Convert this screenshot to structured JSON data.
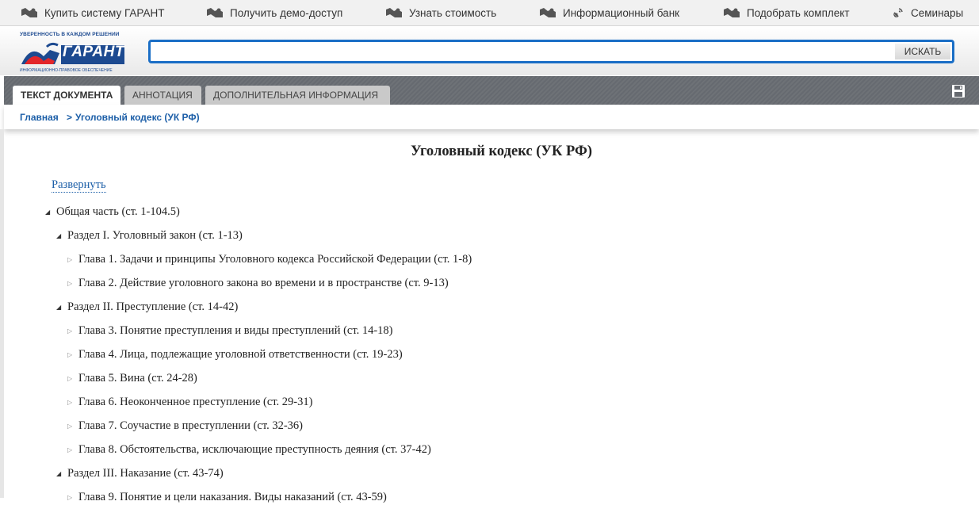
{
  "top_nav": [
    {
      "label": "Купить систему ГАРАНТ",
      "icon": "hand-icon"
    },
    {
      "label": "Получить демо-доступ",
      "icon": "hand-icon"
    },
    {
      "label": "Узнать стоимость",
      "icon": "hand-icon"
    },
    {
      "label": "Информационный банк",
      "icon": "hand-icon"
    },
    {
      "label": "Подобрать комплект",
      "icon": "hand-icon"
    },
    {
      "label": "Семинары",
      "icon": "satellite-icon"
    }
  ],
  "logo": {
    "tagline": "УВЕРЕННОСТЬ В КАЖДОМ РЕШЕНИИ",
    "name": "ГАРАНТ",
    "subtitle": "ИНФОРМАЦИОННО-ПРАВОВОЕ ОБЕСПЕЧЕНИЕ"
  },
  "search": {
    "value": "",
    "button_label": "ИСКАТЬ"
  },
  "tabs": [
    {
      "label": "ТЕКСТ ДОКУМЕНТА",
      "active": true
    },
    {
      "label": "АННОТАЦИЯ",
      "active": false
    },
    {
      "label": "ДОПОЛНИТЕЛЬНАЯ ИНФОРМАЦИЯ",
      "active": false
    }
  ],
  "breadcrumb": {
    "home": "Главная",
    "separator": ">",
    "current": "Уголовный кодекс (УК РФ)"
  },
  "document": {
    "title": "Уголовный кодекс (УК РФ)",
    "expand_label": "Развернуть",
    "tree": [
      {
        "label": "Общая часть (ст. 1-104.5)",
        "level": 0,
        "expanded": true
      },
      {
        "label": "Раздел I. Уголовный закон (ст. 1-13)",
        "level": 1,
        "expanded": true
      },
      {
        "label": "Глава 1. Задачи и принципы Уголовного кодекса Российской Федерации (ст. 1-8)",
        "level": 2,
        "expanded": false
      },
      {
        "label": "Глава 2. Действие уголовного закона во времени и в пространстве (ст. 9-13)",
        "level": 2,
        "expanded": false
      },
      {
        "label": "Раздел II. Преступление (ст. 14-42)",
        "level": 1,
        "expanded": true
      },
      {
        "label": "Глава 3. Понятие преступления и виды преступлений (ст. 14-18)",
        "level": 2,
        "expanded": false
      },
      {
        "label": "Глава 4. Лица, подлежащие уголовной ответственности (ст. 19-23)",
        "level": 2,
        "expanded": false
      },
      {
        "label": "Глава 5. Вина (ст. 24-28)",
        "level": 2,
        "expanded": false
      },
      {
        "label": "Глава 6. Неоконченное преступление (ст. 29-31)",
        "level": 2,
        "expanded": false
      },
      {
        "label": "Глава 7. Соучастие в преступлении (ст. 32-36)",
        "level": 2,
        "expanded": false
      },
      {
        "label": "Глава 8. Обстоятельства, исключающие преступность деяния (ст. 37-42)",
        "level": 2,
        "expanded": false
      },
      {
        "label": "Раздел III. Наказание (ст. 43-74)",
        "level": 1,
        "expanded": true
      },
      {
        "label": "Глава 9. Понятие и цели наказания. Виды наказаний (ст. 43-59)",
        "level": 2,
        "expanded": false
      }
    ]
  },
  "colors": {
    "accent": "#1a6ec6",
    "link": "#1d5fa8",
    "tabstrip": "#666a70"
  }
}
